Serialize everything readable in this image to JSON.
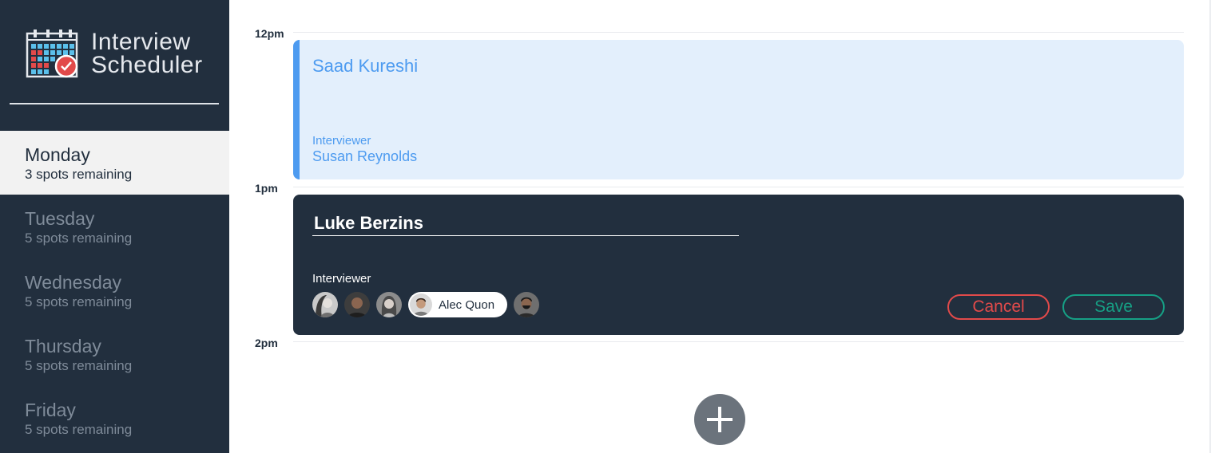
{
  "app": {
    "title": "Interview Scheduler",
    "logo_icon": "calendar-check-icon"
  },
  "sidebar": {
    "days": [
      {
        "name": "Monday",
        "spots": "3 spots remaining",
        "selected": true
      },
      {
        "name": "Tuesday",
        "spots": "5 spots remaining",
        "selected": false
      },
      {
        "name": "Wednesday",
        "spots": "5 spots remaining",
        "selected": false
      },
      {
        "name": "Thursday",
        "spots": "5 spots remaining",
        "selected": false
      },
      {
        "name": "Friday",
        "spots": "5 spots remaining",
        "selected": false
      }
    ]
  },
  "schedule": {
    "times": [
      "12pm",
      "1pm",
      "2pm"
    ],
    "appointment": {
      "student": "Saad Kureshi",
      "interviewer_label": "Interviewer",
      "interviewer": "Susan Reynolds"
    },
    "form": {
      "student_value": "Luke Berzins",
      "interviewer_label": "Interviewer",
      "selected_interviewer": "Alec Quon",
      "avatar_count": 5,
      "cancel_label": "Cancel",
      "save_label": "Save"
    },
    "add_icon": "plus-icon"
  },
  "colors": {
    "sidebar_bg": "#222f3e",
    "selected_day_bg": "#f2f2f2",
    "appointment_accent": "#4d9bf0",
    "appointment_bg": "#e3effc",
    "form_bg": "#222f3e",
    "cancel": "#e24a4a",
    "save": "#16a085",
    "add_button": "#6b737c"
  }
}
